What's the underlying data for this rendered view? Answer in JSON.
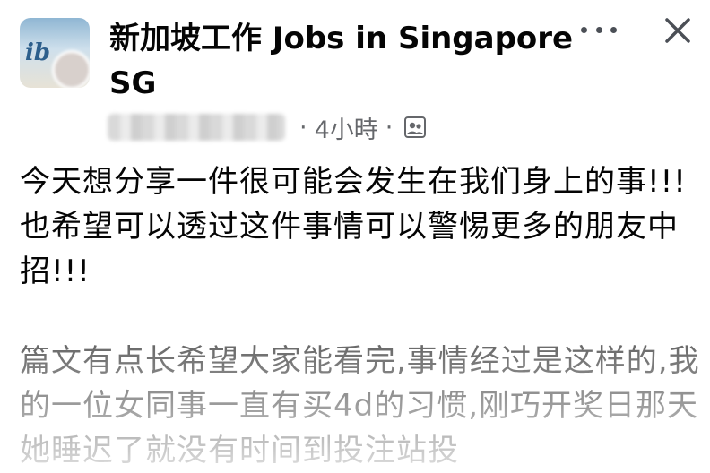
{
  "header": {
    "group_name": "新加坡工作 Jobs in Singapore SG",
    "avatar_mark": "ib",
    "more_label": "•••"
  },
  "meta": {
    "time": "4小時",
    "separator": "·"
  },
  "post": {
    "paragraphs": [
      "今天想分享一件很可能会发生在我们身上的事!!!也希望可以透过这件事情可以警惕更多的朋友中招!!!",
      "篇文有点长希望大家能看完,事情经过是这样的,我的一位女同事一直有买4d的习惯,刚巧开奖日那天她睡迟了就没有时间到投注站投"
    ]
  },
  "icons": {
    "more": "more-horizontal-icon",
    "close": "close-icon",
    "audience": "group-members-icon"
  },
  "colors": {
    "text": "#050505",
    "meta": "#65676b",
    "icon": "#4b4f56"
  }
}
